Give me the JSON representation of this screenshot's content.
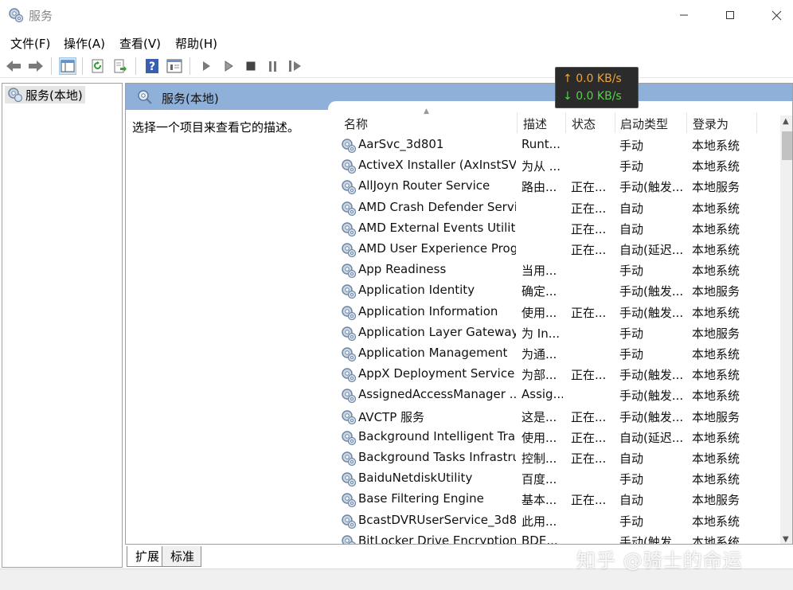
{
  "window": {
    "title": "服务"
  },
  "menu": [
    "文件(F)",
    "操作(A)",
    "查看(V)",
    "帮助(H)"
  ],
  "tree": {
    "root_label": "服务(本地)"
  },
  "panel": {
    "header": "服务(本地)",
    "description": "选择一个项目来查看它的描述。"
  },
  "columns": {
    "name": "名称",
    "desc": "描述",
    "status": "状态",
    "start": "启动类型",
    "logon": "登录为"
  },
  "services": [
    {
      "name": "AarSvc_3d801",
      "desc": "Runt...",
      "status": "",
      "start": "手动",
      "logon": "本地系统"
    },
    {
      "name": "ActiveX Installer (AxInstSV)",
      "desc": "为从 ...",
      "status": "",
      "start": "手动",
      "logon": "本地系统"
    },
    {
      "name": "AllJoyn Router Service",
      "desc": "路由...",
      "status": "正在...",
      "start": "手动(触发...",
      "logon": "本地服务"
    },
    {
      "name": "AMD Crash Defender Servi...",
      "desc": "",
      "status": "正在...",
      "start": "自动",
      "logon": "本地系统"
    },
    {
      "name": "AMD External Events Utility",
      "desc": "",
      "status": "正在...",
      "start": "自动",
      "logon": "本地系统"
    },
    {
      "name": "AMD User Experience Prog...",
      "desc": "",
      "status": "正在...",
      "start": "自动(延迟...",
      "logon": "本地系统"
    },
    {
      "name": "App Readiness",
      "desc": "当用...",
      "status": "",
      "start": "手动",
      "logon": "本地系统"
    },
    {
      "name": "Application Identity",
      "desc": "确定...",
      "status": "",
      "start": "手动(触发...",
      "logon": "本地服务"
    },
    {
      "name": "Application Information",
      "desc": "使用...",
      "status": "正在...",
      "start": "手动(触发...",
      "logon": "本地系统"
    },
    {
      "name": "Application Layer Gateway ...",
      "desc": "为 In...",
      "status": "",
      "start": "手动",
      "logon": "本地服务"
    },
    {
      "name": "Application Management",
      "desc": "为通...",
      "status": "",
      "start": "手动",
      "logon": "本地系统"
    },
    {
      "name": "AppX Deployment Service ...",
      "desc": "为部...",
      "status": "正在...",
      "start": "手动(触发...",
      "logon": "本地系统"
    },
    {
      "name": "AssignedAccessManager ...",
      "desc": "Assig...",
      "status": "",
      "start": "手动(触发...",
      "logon": "本地系统"
    },
    {
      "name": "AVCTP 服务",
      "desc": "这是...",
      "status": "正在...",
      "start": "手动(触发...",
      "logon": "本地服务"
    },
    {
      "name": "Background Intelligent Tra...",
      "desc": "使用...",
      "status": "正在...",
      "start": "自动(延迟...",
      "logon": "本地系统"
    },
    {
      "name": "Background Tasks Infrastru...",
      "desc": "控制...",
      "status": "正在...",
      "start": "自动",
      "logon": "本地系统"
    },
    {
      "name": "BaiduNetdiskUtility",
      "desc": "百度...",
      "status": "",
      "start": "手动",
      "logon": "本地系统"
    },
    {
      "name": "Base Filtering Engine",
      "desc": "基本...",
      "status": "正在...",
      "start": "自动",
      "logon": "本地服务"
    },
    {
      "name": "BcastDVRUserService_3d8...",
      "desc": "此用...",
      "status": "",
      "start": "手动",
      "logon": "本地系统"
    },
    {
      "name": "BitLocker Drive Encryption ...",
      "desc": "BDE...",
      "status": "",
      "start": "手动(触发...",
      "logon": "本地系统"
    }
  ],
  "tabs": {
    "extended": "扩展",
    "standard": "标准"
  },
  "netspeed": {
    "upload": "0.0 KB/s",
    "download": "0.0 KB/s"
  },
  "watermark": "知乎 @骑士的命运",
  "colors": {
    "header_blue": "#8fb0d9",
    "upload": "#f0a33a",
    "download": "#55d24a"
  }
}
